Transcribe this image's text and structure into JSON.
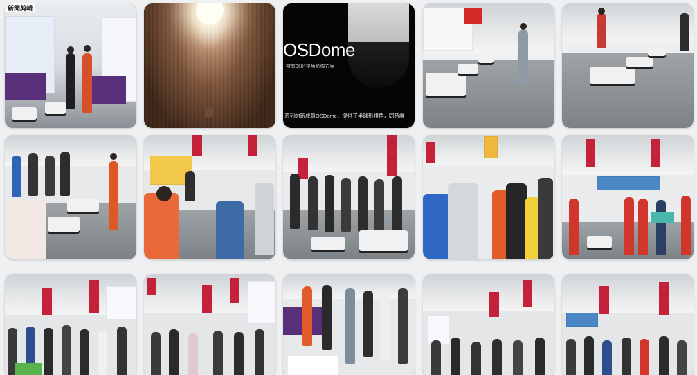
{
  "gallery": {
    "corner_text": "新聞剪輯",
    "promo": {
      "title": "OSDome",
      "subtitle": "擁有360°視角影像方案",
      "caption": "系列的新成員OSDome，提供了半球形視角，同時讓"
    },
    "tiles": [
      {
        "label": "Booth with robots and visitors",
        "theme": "booth"
      },
      {
        "label": "Tunnel light art",
        "theme": "tunnel"
      },
      {
        "label": "OSDome promotion",
        "theme": "promo"
      },
      {
        "label": "Robots on expo floor",
        "theme": "floor"
      },
      {
        "label": "Robot demo in aisle",
        "theme": "floor"
      },
      {
        "label": "Robot arm demonstration",
        "theme": "crowd"
      },
      {
        "label": "Staff presenting to visitors",
        "theme": "crowd"
      },
      {
        "label": "Robots displayed to crowd",
        "theme": "crowd"
      },
      {
        "label": "Visitors watching demo",
        "theme": "crowd"
      },
      {
        "label": "Team photo at booth",
        "theme": "crowd"
      },
      {
        "label": "Crowd in expo hall",
        "theme": "crowd"
      },
      {
        "label": "Visitors gathering",
        "theme": "crowd"
      },
      {
        "label": "Guests at booth desk",
        "theme": "crowd"
      },
      {
        "label": "Busy hall entrance",
        "theme": "crowd"
      },
      {
        "label": "Crowded booth area",
        "theme": "crowd"
      }
    ]
  }
}
